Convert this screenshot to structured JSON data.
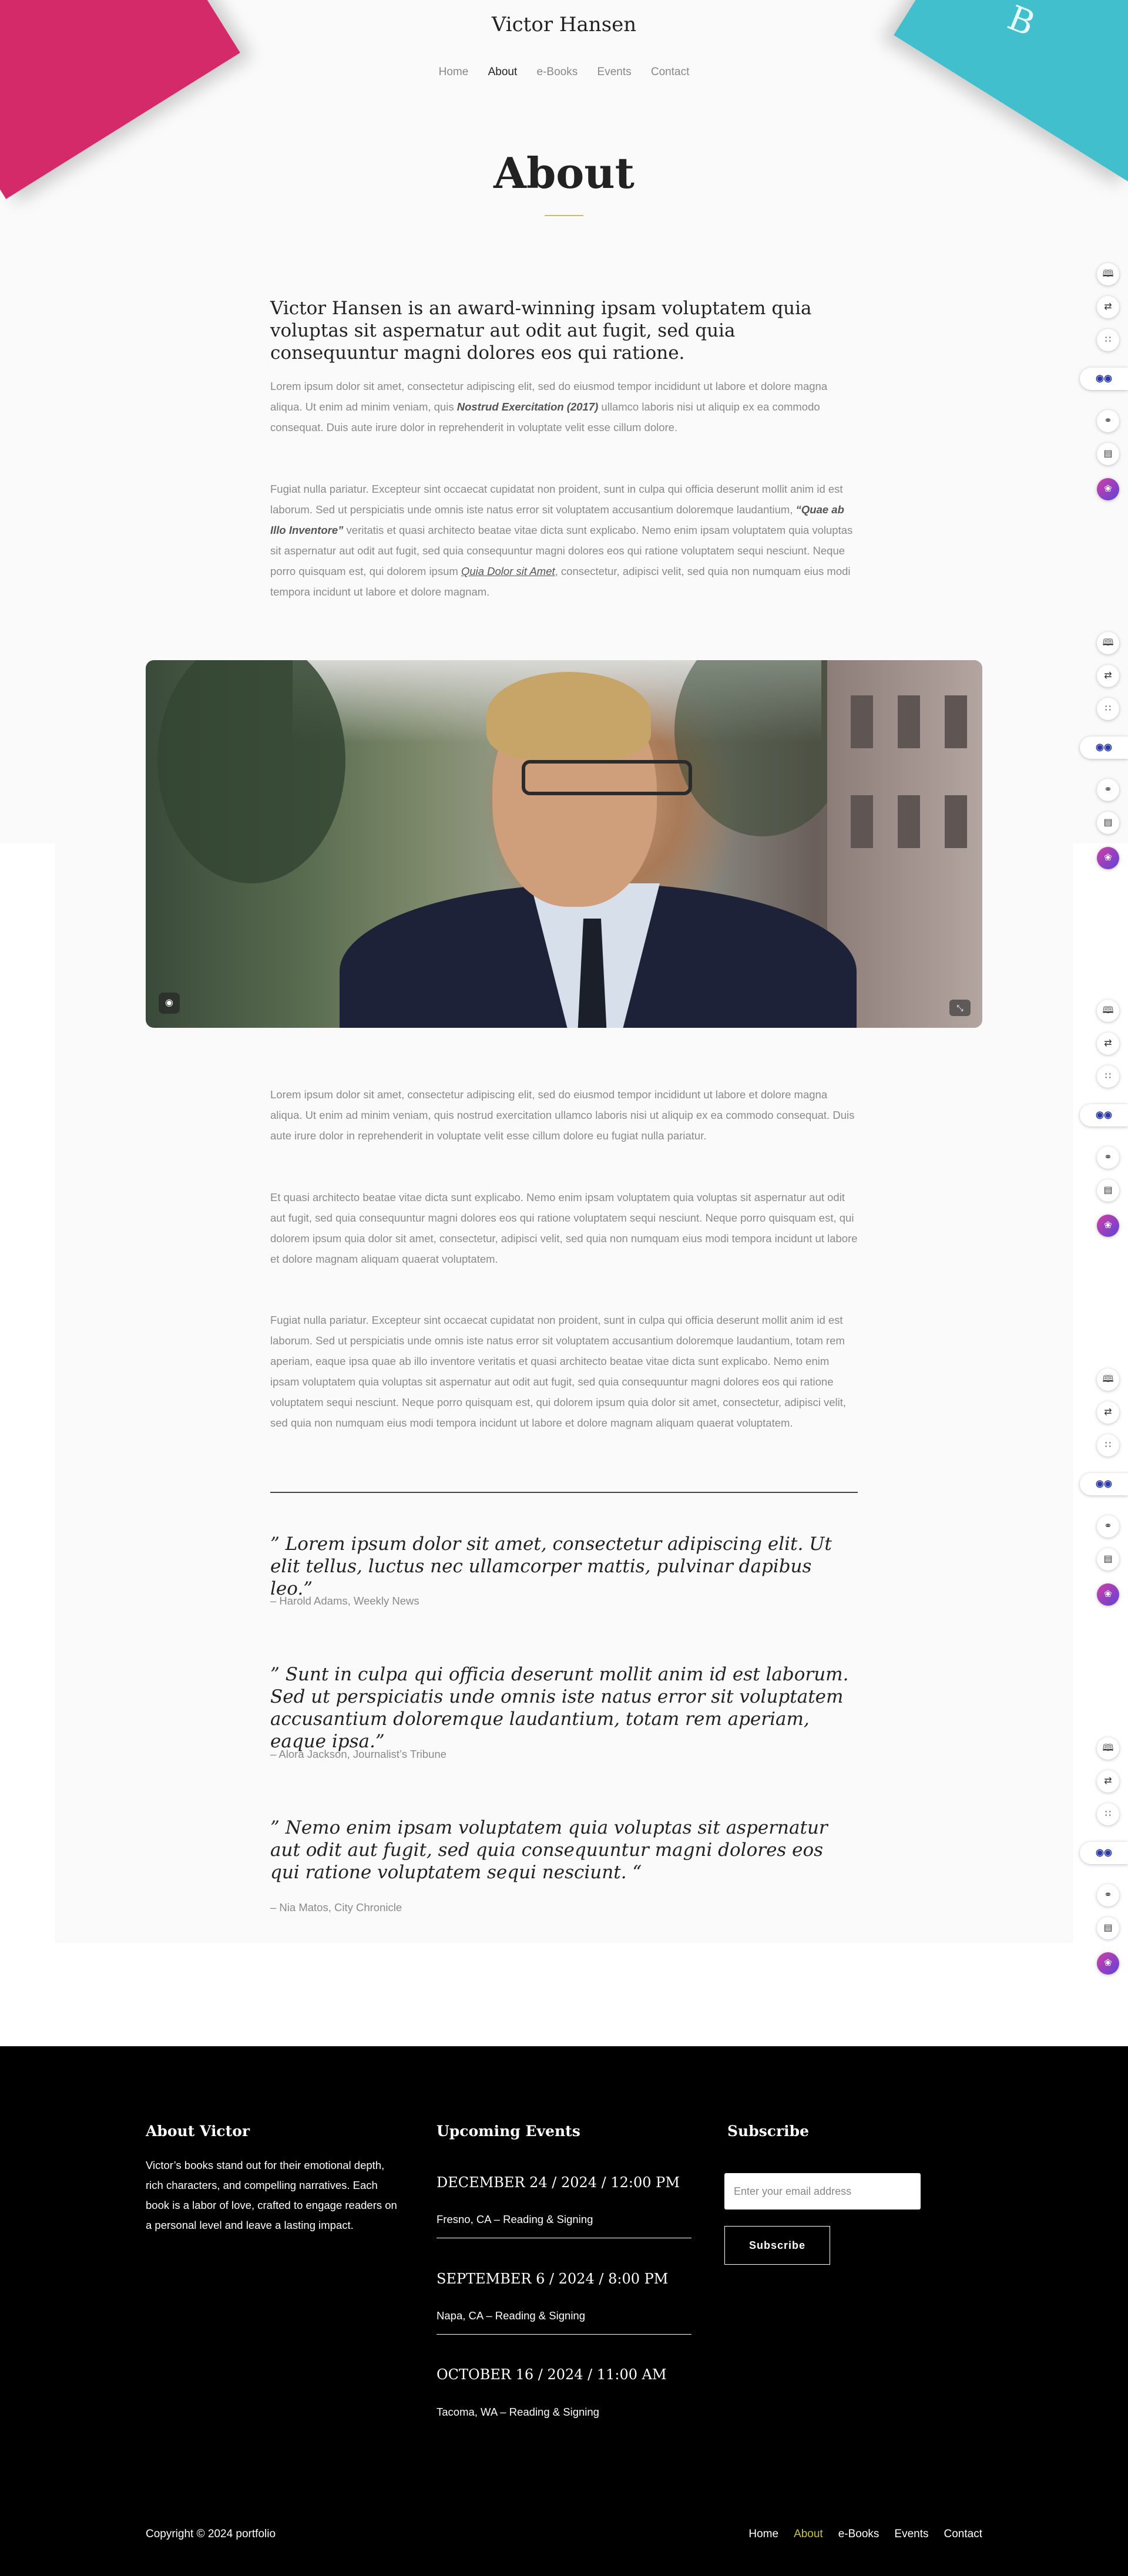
{
  "site": {
    "title": "Victor Hansen"
  },
  "nav": [
    "Home",
    "About",
    "e-Books",
    "Events",
    "Contact"
  ],
  "page": {
    "title": "About"
  },
  "lead": "Victor Hansen is an award-winning ipsam voluptatem quia voluptas sit aspernatur aut odit aut fugit, sed quia consequuntur magni dolores eos qui ratione.",
  "intro": {
    "p1_a": "Lorem ipsum dolor sit amet, consectetur adipiscing elit, sed do eiusmod tempor incididunt ut labore et dolore magna aliqua. Ut enim ad minim veniam, quis ",
    "p1_em": "Nostrud Exercitation (2017)",
    "p1_b": " ullamco laboris nisi ut aliquip ex ea commodo consequat. Duis aute irure dolor in reprehenderit in voluptate velit esse cillum dolore.",
    "p2_a": "Fugiat nulla pariatur. Excepteur sint occaecat cupidatat non proident, sunt in culpa qui officia deserunt mollit anim id est laborum. Sed ut perspiciatis unde omnis iste natus error sit voluptatem accusantium doloremque laudantium, ",
    "p2_em": "“Quae ab Illo Inventore”",
    "p2_b": " veritatis et quasi architecto beatae vitae dicta sunt explicabo. Nemo enim ipsam voluptatem quia voluptas sit aspernatur aut odit aut fugit, sed quia consequuntur magni dolores eos qui ratione voluptatem sequi nesciunt. Neque porro quisquam est, qui dolorem ipsum ",
    "p2_link": "Quia Dolor sit Amet",
    "p2_c": ", consectetur, adipisci velit, sed quia non numquam eius modi tempora incidunt ut labore et dolore magnam."
  },
  "body": {
    "p1": "Lorem ipsum dolor sit amet, consectetur adipiscing elit, sed do eiusmod tempor incididunt ut labore et dolore magna aliqua. Ut enim ad minim veniam, quis nostrud exercitation ullamco laboris nisi ut aliquip ex ea commodo consequat. Duis aute irure dolor in reprehenderit in voluptate velit esse cillum dolore eu fugiat nulla pariatur.",
    "p2": "Et quasi architecto beatae vitae dicta sunt explicabo. Nemo enim ipsam voluptatem quia voluptas sit aspernatur aut odit aut fugit, sed quia consequuntur magni dolores eos qui ratione voluptatem sequi nesciunt. Neque porro quisquam est, qui dolorem ipsum quia dolor sit amet, consectetur, adipisci velit, sed quia non numquam eius modi tempora incidunt ut labore et dolore magnam aliquam quaerat voluptatem.",
    "p3": "Fugiat nulla pariatur. Excepteur sint occaecat cupidatat non proident, sunt in culpa qui officia deserunt mollit anim id est laborum. Sed ut perspiciatis unde omnis iste natus error sit voluptatem accusantium doloremque laudantium, totam rem aperiam, eaque ipsa quae ab illo inventore veritatis et quasi architecto beatae vitae dicta sunt explicabo. Nemo enim ipsam voluptatem quia voluptas sit aspernatur aut odit aut fugit, sed quia consequuntur magni dolores eos qui ratione voluptatem sequi nesciunt. Neque porro quisquam est, qui dolorem ipsum quia dolor sit amet, consectetur, adipisci velit, sed quia non numquam eius modi tempora incidunt ut labore et dolore magnam aliquam quaerat voluptatem."
  },
  "quotes": [
    {
      "text": "” Lorem ipsum dolor sit amet, consectetur adipiscing elit. Ut elit tellus, luctus nec ullamcorper mattis, pulvinar dapibus leo.”",
      "cite": "– Harold Adams, Weekly News"
    },
    {
      "text": "” Sunt in culpa qui officia deserunt mollit anim id est laborum. Sed ut perspiciatis unde omnis iste natus error sit voluptatem accusantium doloremque laudantium, totam rem aperiam, eaque ipsa.”",
      "cite": "– Alora Jackson, Journalist’s Tribune"
    },
    {
      "text": "” Nemo enim ipsam voluptatem quia voluptas sit aspernatur aut odit aut fugit, sed quia consequuntur magni dolores eos qui ratione voluptatem sequi nesciunt. “",
      "cite": "– Nia Matos, City Chronicle"
    }
  ],
  "footer": {
    "about_heading": "About Victor",
    "about_text": "Victor’s books stand out for their emotional depth, rich characters, and compelling narratives. Each book is a labor of love, crafted to engage readers on a personal level and leave a lasting impact.",
    "events_heading": "Upcoming Events",
    "events": [
      {
        "date": "DECEMBER 24 / 2024 / 12:00 PM",
        "location": "Fresno, CA – Reading & Signing"
      },
      {
        "date": "SEPTEMBER 6 / 2024 / 8:00 PM",
        "location": "Napa, CA – Reading & Signing"
      },
      {
        "date": "OCTOBER 16 / 2024 / 11:00 AM",
        "location": "Tacoma, WA – Reading & Signing"
      }
    ],
    "subscribe_heading": "Subscribe",
    "subscribe_placeholder": "Enter your email address",
    "subscribe_button": "Subscribe",
    "copyright": "Copyright © 2024 portfolio",
    "nav": [
      "Home",
      "About",
      "e-Books",
      "Events",
      "Contact"
    ]
  },
  "theme": {
    "accent": "#c8c24a",
    "footer_bg": "#000000",
    "book_left": "#d42a6a",
    "book_right": "#42bfcc"
  },
  "icons": {
    "widgets": [
      "book-icon",
      "translate-icon",
      "apps-grid-icon",
      "eyes-icon",
      "link-icon",
      "reader-icon",
      "brain-icon"
    ]
  }
}
